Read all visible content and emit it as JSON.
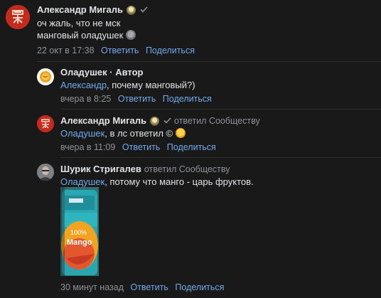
{
  "comments": [
    {
      "author": "Александр Мигаль",
      "text_lines": [
        "оч жаль, что не мск",
        "манговый оладушек"
      ],
      "time": "22 окт в 17:38",
      "reply_label": "Ответить",
      "share_label": "Поделиться"
    },
    {
      "author": "Оладушек · Автор",
      "mention": "Александр",
      "text": ", почему манговый?)",
      "time": "вчера в 8:25",
      "reply_label": "Ответить",
      "share_label": "Поделиться"
    },
    {
      "author": "Александр Мигаль",
      "replied": "ответил Сообществу",
      "mention": "Оладушек",
      "text": ", в лс ответил ©",
      "time": "вчера в 11:09",
      "reply_label": "Ответить",
      "share_label": "Поделиться"
    },
    {
      "author": "Шурик Стригалев",
      "replied": "ответил Сообществу",
      "mention": "Оладушек",
      "text": ", потому что манго - царь фруктов.",
      "time": "30 минут назад",
      "reply_label": "Ответить",
      "share_label": "Поделиться"
    }
  ],
  "colors": {
    "background": "#19191a",
    "text": "#e1e3e6",
    "secondary": "#8d939a",
    "link": "#71aaeb",
    "divider": "#2c2d2e"
  },
  "icons": {
    "verified": "check-icon",
    "emoji_face": "emoji-icon",
    "laugh": "rofl-emoji-icon"
  },
  "attachment_image_text": [
    "100%",
    "Mango"
  ]
}
